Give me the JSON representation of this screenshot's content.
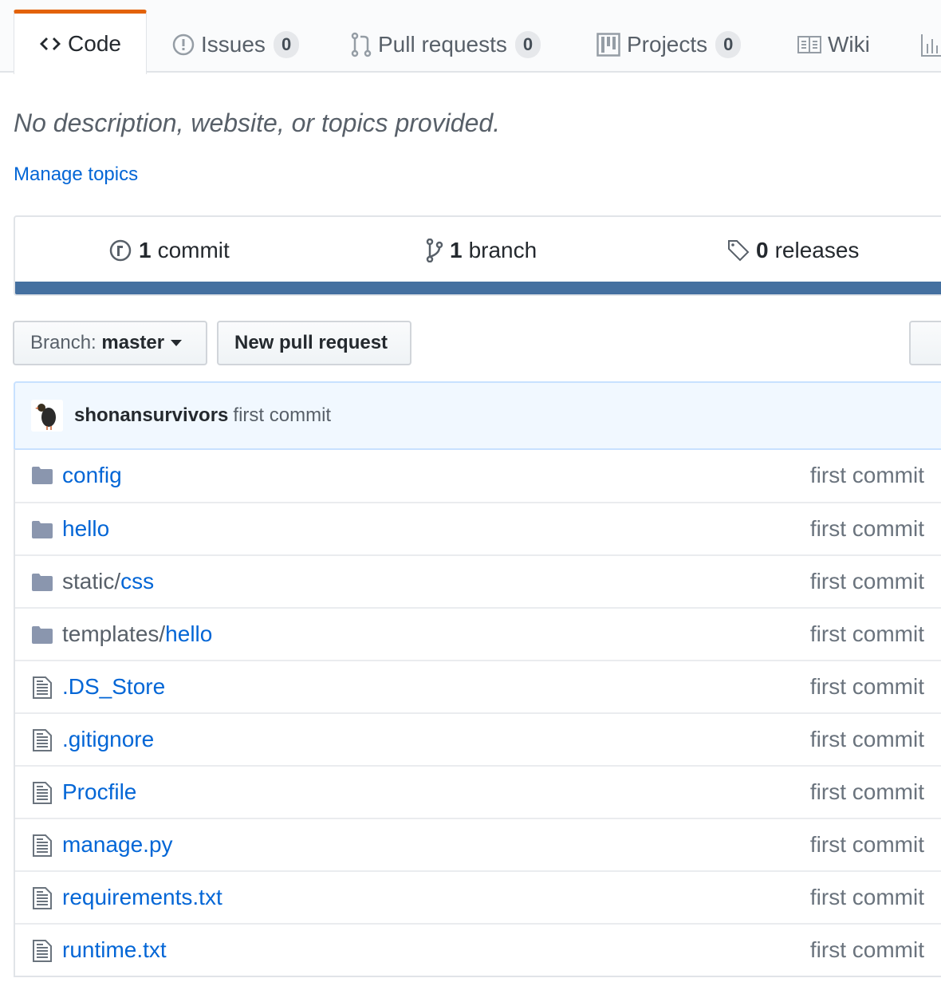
{
  "tabs": [
    {
      "label": "Code",
      "icon": "code-icon",
      "selected": true
    },
    {
      "label": "Issues",
      "count": "0",
      "icon": "issue-opened-icon"
    },
    {
      "label": "Pull requests",
      "count": "0",
      "icon": "git-pull-request-icon"
    },
    {
      "label": "Projects",
      "count": "0",
      "icon": "project-icon"
    },
    {
      "label": "Wiki",
      "icon": "book-icon"
    },
    {
      "icon": "graph-icon"
    }
  ],
  "description": "No description, website, or topics provided.",
  "manage_topics": "Manage topics",
  "summary": {
    "commits": {
      "num": "1",
      "label": "commit"
    },
    "branches": {
      "num": "1",
      "label": "branch"
    },
    "releases": {
      "num": "0",
      "label": "releases"
    },
    "language_bar_color": "#4470a0"
  },
  "toolbar": {
    "branch_prefix": "Branch:",
    "branch": "master",
    "new_pr": "New pull request"
  },
  "latest_commit": {
    "author": "shonansurvivors",
    "message": "first commit"
  },
  "files": [
    {
      "type": "dir",
      "prefix": "",
      "name": "config",
      "commit": "first commit"
    },
    {
      "type": "dir",
      "prefix": "",
      "name": "hello",
      "commit": "first commit"
    },
    {
      "type": "dir",
      "prefix": "static/",
      "name": "css",
      "commit": "first commit"
    },
    {
      "type": "dir",
      "prefix": "templates/",
      "name": "hello",
      "commit": "first commit"
    },
    {
      "type": "file",
      "prefix": "",
      "name": ".DS_Store",
      "commit": "first commit"
    },
    {
      "type": "file",
      "prefix": "",
      "name": ".gitignore",
      "commit": "first commit"
    },
    {
      "type": "file",
      "prefix": "",
      "name": "Procfile",
      "commit": "first commit"
    },
    {
      "type": "file",
      "prefix": "",
      "name": "manage.py",
      "commit": "first commit"
    },
    {
      "type": "file",
      "prefix": "",
      "name": "requirements.txt",
      "commit": "first commit"
    },
    {
      "type": "file",
      "prefix": "",
      "name": "runtime.txt",
      "commit": "first commit"
    }
  ],
  "colors": {
    "accent": "#e36209",
    "link": "#0366d6"
  }
}
